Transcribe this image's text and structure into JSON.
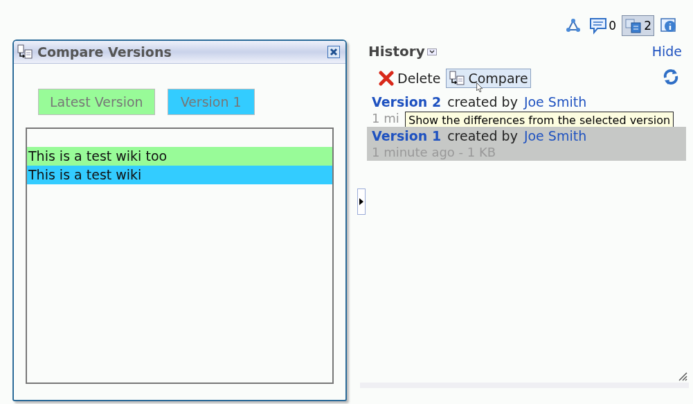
{
  "toolbar": [
    {
      "kind": "graph",
      "selected": false
    },
    {
      "kind": "comments",
      "count": "0",
      "selected": false
    },
    {
      "kind": "versions",
      "count": "2",
      "selected": true
    },
    {
      "kind": "info",
      "selected": false
    }
  ],
  "history": {
    "title": "History",
    "hide": "Hide",
    "actions": [
      {
        "kind": "delete",
        "label": "Delete"
      },
      {
        "kind": "compare",
        "label": "Compare"
      }
    ],
    "versions": [
      {
        "name": "Version 2",
        "created_by": "created by",
        "author": "Joe Smith",
        "meta": "1 mi",
        "selected": false
      },
      {
        "name": "Version 1",
        "created_by": "created by",
        "author": "Joe Smith",
        "meta": "1 minute ago - 1 KB",
        "selected": true
      }
    ],
    "tooltip": "Show the differences from the selected version"
  },
  "dialog": {
    "title": "Compare Versions",
    "legend": [
      {
        "label": "Latest Version",
        "color": "#98fb98"
      },
      {
        "label": "Version 1",
        "color": "#33ccff"
      }
    ],
    "lines": [
      {
        "text": "This is a test wiki too",
        "color": "#98fb98"
      },
      {
        "text": "This is a test wiki",
        "color": "#33ccff"
      }
    ]
  }
}
